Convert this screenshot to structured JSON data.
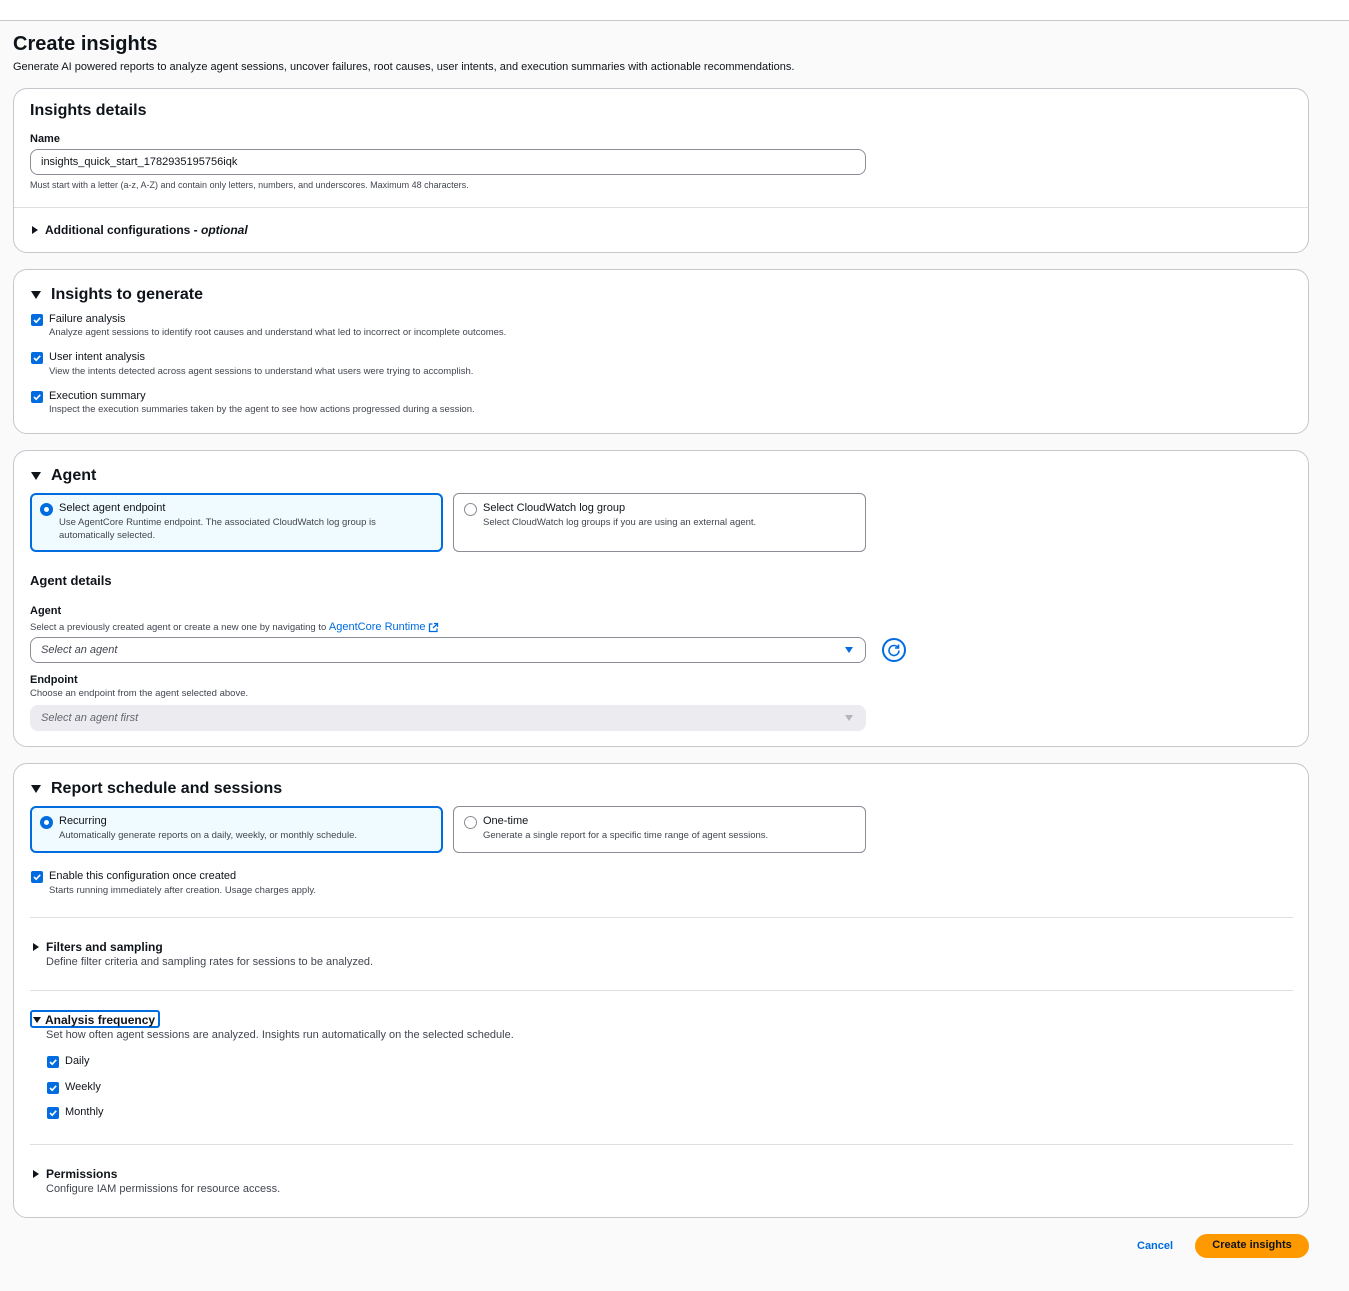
{
  "page": {
    "title": "Create insights",
    "description": "Generate AI powered reports to analyze agent sessions, uncover failures, root causes, user intents, and execution summaries with actionable recommendations."
  },
  "insights_details": {
    "title": "Insights details",
    "name_label": "Name",
    "name_value": "insights_quick_start_1782935195756iqk",
    "name_hint": "Must start with a letter (a-z, A-Z) and contain only letters, numbers, and underscores. Maximum 48 characters.",
    "additional_label": "Additional configurations - ",
    "additional_optional": "optional"
  },
  "insights_to_generate": {
    "title": "Insights to generate",
    "options": [
      {
        "label": "Failure analysis",
        "desc": "Analyze agent sessions to identify root causes and understand what led to incorrect or incomplete outcomes.",
        "checked": true
      },
      {
        "label": "User intent analysis",
        "desc": "View the intents detected across agent sessions to understand what users were trying to accomplish.",
        "checked": true
      },
      {
        "label": "Execution summary",
        "desc": "Inspect the execution summaries taken by the agent to see how actions progressed during a session.",
        "checked": true
      }
    ]
  },
  "agent": {
    "title": "Agent",
    "tiles": [
      {
        "title": "Select agent endpoint",
        "desc": "Use AgentCore Runtime endpoint. The associated CloudWatch log group is automatically selected.",
        "selected": true
      },
      {
        "title": "Select CloudWatch log group",
        "desc": "Select CloudWatch log groups if you are using an external agent.",
        "selected": false
      }
    ],
    "details_title": "Agent details",
    "agent_label": "Agent",
    "agent_desc": "Select a previously created agent or create a new one by navigating to ",
    "agent_link": "AgentCore Runtime",
    "agent_placeholder": "Select an agent",
    "endpoint_label": "Endpoint",
    "endpoint_desc": "Choose an endpoint from the agent selected above.",
    "endpoint_placeholder": "Select an agent first"
  },
  "schedule": {
    "title": "Report schedule and sessions",
    "tiles": [
      {
        "title": "Recurring",
        "desc": "Automatically generate reports on a daily, weekly, or monthly schedule.",
        "selected": true
      },
      {
        "title": "One-time",
        "desc": "Generate a single report for a specific time range of agent sessions.",
        "selected": false
      }
    ],
    "enable_label": "Enable this configuration once created",
    "enable_desc": "Starts running immediately after creation. Usage charges apply.",
    "enable_checked": true,
    "filters_title": "Filters and sampling",
    "filters_desc": "Define filter criteria and sampling rates for sessions to be analyzed.",
    "frequency_title": "Analysis frequency",
    "frequency_desc": "Set how often agent sessions are analyzed. Insights run automatically on the selected schedule.",
    "frequency_options": [
      {
        "label": "Daily",
        "checked": true
      },
      {
        "label": "Weekly",
        "checked": true
      },
      {
        "label": "Monthly",
        "checked": true
      }
    ],
    "permissions_title": "Permissions",
    "permissions_desc": "Configure IAM permissions for resource access."
  },
  "footer": {
    "cancel_label": "Cancel",
    "create_label": "Create insights"
  },
  "colors": {
    "accent": "#006ce0",
    "primary_button": "#ff9900",
    "border": "#c6c6cd"
  }
}
